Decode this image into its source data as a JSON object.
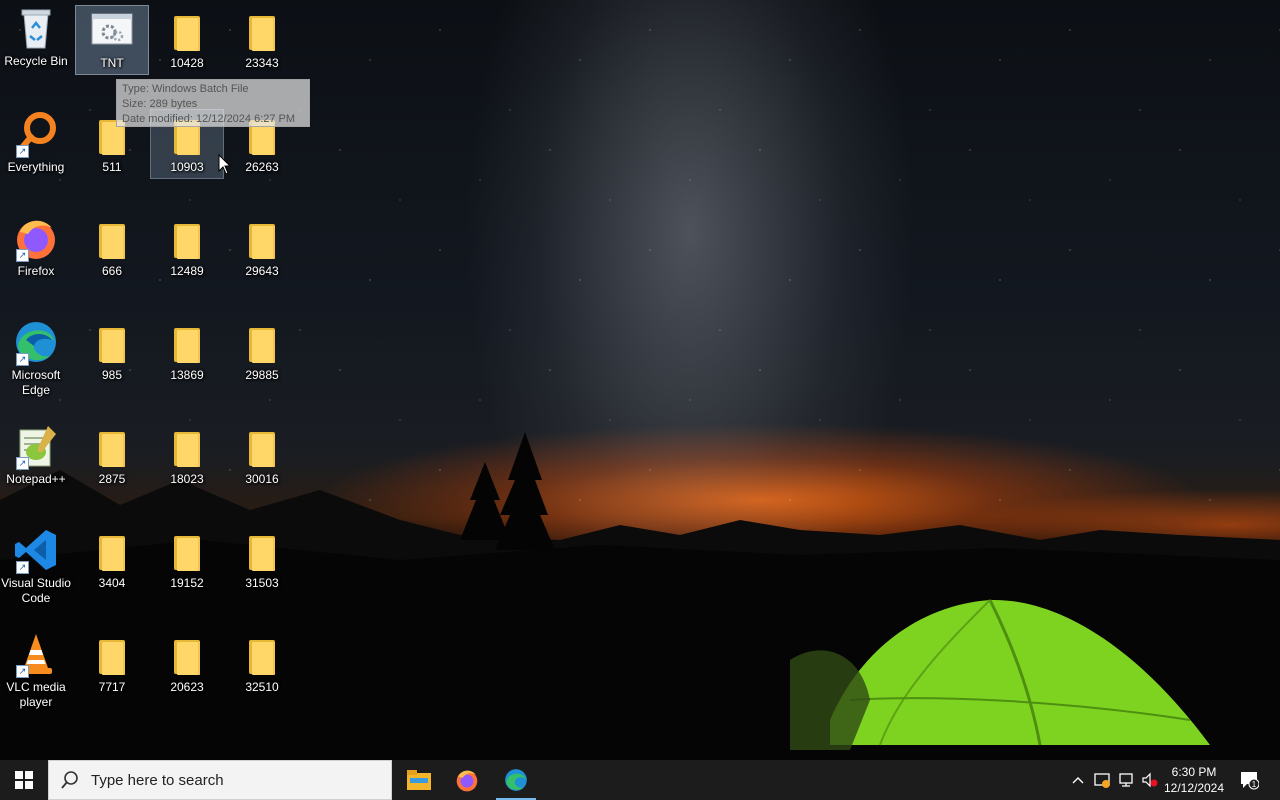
{
  "desktop": {
    "icons": [
      {
        "id": "recycle",
        "label": "Recycle Bin"
      },
      {
        "id": "everything",
        "label": "Everything"
      },
      {
        "id": "firefox",
        "label": "Firefox"
      },
      {
        "id": "edge",
        "label": "Microsoft Edge"
      },
      {
        "id": "notepadpp",
        "label": "Notepad++"
      },
      {
        "id": "vscode",
        "label": "Visual Studio Code"
      },
      {
        "id": "vlc",
        "label": "VLC media player"
      }
    ],
    "files": [
      {
        "label": "TNT"
      },
      {
        "label": "511"
      },
      {
        "label": "666"
      },
      {
        "label": "985"
      },
      {
        "label": "2875"
      },
      {
        "label": "3404"
      },
      {
        "label": "7717"
      },
      {
        "label": "10428"
      },
      {
        "label": "10903"
      },
      {
        "label": "12489"
      },
      {
        "label": "13869"
      },
      {
        "label": "18023"
      },
      {
        "label": "19152"
      },
      {
        "label": "20623"
      },
      {
        "label": "23343"
      },
      {
        "label": "26263"
      },
      {
        "label": "29643"
      },
      {
        "label": "29885"
      },
      {
        "label": "30016"
      },
      {
        "label": "31503"
      },
      {
        "label": "32510"
      }
    ]
  },
  "tooltip": {
    "type": "Type: Windows Batch File",
    "size": "Size: 289 bytes",
    "modified": "Date modified: 12/12/2024 6:27 PM"
  },
  "taskbar": {
    "search_placeholder": "Type here to search",
    "clock_time": "6:30 PM",
    "clock_date": "12/12/2024",
    "notification_count": "1"
  }
}
